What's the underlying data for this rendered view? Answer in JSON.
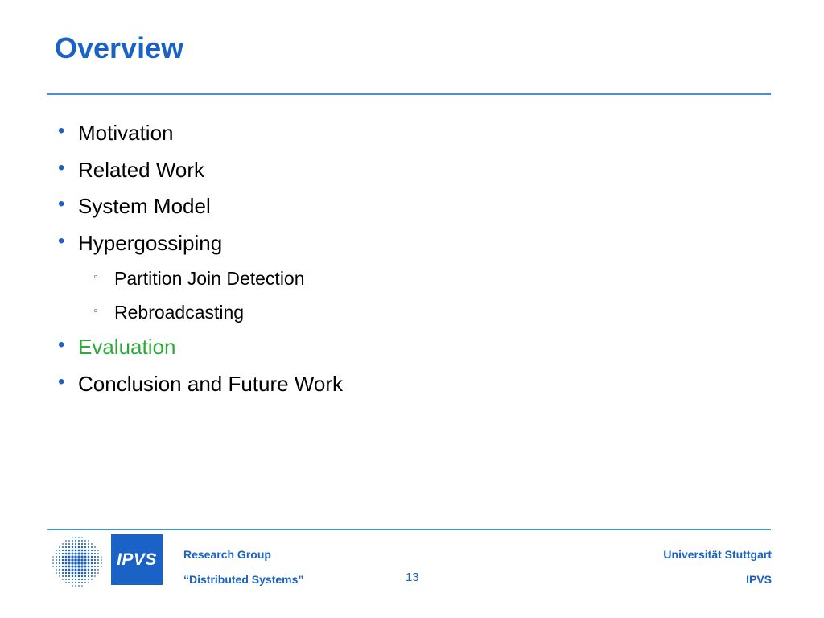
{
  "slide": {
    "title": "Overview",
    "bullets": [
      {
        "level": 1,
        "text": "Motivation",
        "highlight": false
      },
      {
        "level": 1,
        "text": "Related Work",
        "highlight": false
      },
      {
        "level": 1,
        "text": "System Model",
        "highlight": false
      },
      {
        "level": 1,
        "text": "Hypergossiping",
        "highlight": false
      },
      {
        "level": 2,
        "text": "Partition Join Detection",
        "highlight": false
      },
      {
        "level": 2,
        "text": "Rebroadcasting",
        "highlight": false
      },
      {
        "level": 1,
        "text": "Evaluation",
        "highlight": true
      },
      {
        "level": 1,
        "text": "Conclusion and Future Work",
        "highlight": false
      }
    ]
  },
  "footer": {
    "logo_label": "IPVS",
    "group_line1": "Research Group",
    "group_line2": "“Distributed Systems”",
    "page_number": "13",
    "university": "Universität Stuttgart",
    "institute": "IPVS"
  },
  "colors": {
    "accent": "#1a62c5",
    "highlight": "#2eaa3a",
    "rule": "#4a90d9"
  }
}
